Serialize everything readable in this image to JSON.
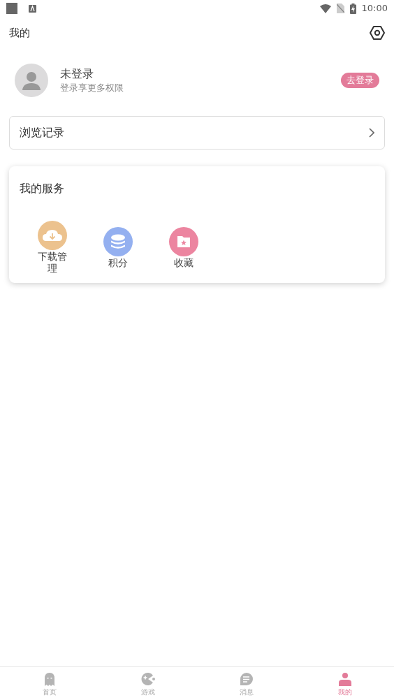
{
  "status_bar": {
    "time": "10:00"
  },
  "header": {
    "title": "我的"
  },
  "profile": {
    "name": "未登录",
    "subtitle": "登录享更多权限",
    "login_button": "去登录"
  },
  "history": {
    "label": "浏览记录"
  },
  "services": {
    "title": "我的服务",
    "items": [
      {
        "kind": "download",
        "label": "下载管理",
        "color": "#ecc28e"
      },
      {
        "kind": "points",
        "label": "积分",
        "color": "#94b0f0"
      },
      {
        "kind": "favorites",
        "label": "收藏",
        "color": "#ec85a0"
      }
    ]
  },
  "tabs": [
    {
      "kind": "home",
      "label": "首页",
      "selected": false
    },
    {
      "kind": "games",
      "label": "游戏",
      "selected": false
    },
    {
      "kind": "messages",
      "label": "消息",
      "selected": false
    },
    {
      "kind": "me",
      "label": "我的",
      "selected": true
    }
  ]
}
